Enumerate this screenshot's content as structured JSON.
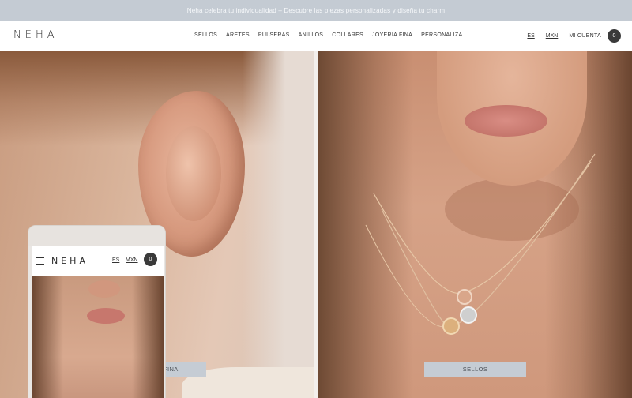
{
  "announcement": {
    "text": "Neha celebra tu individualidad – Descubre las piezas personalizadas y diseña tu charm"
  },
  "header": {
    "logo": "NEHA",
    "nav": [
      "SELLOS",
      "ARETES",
      "PULSERAS",
      "ANILLOS",
      "COLLARES",
      "JOYERIA FINA",
      "PERSONALIZA"
    ],
    "lang": "ES",
    "currency": "MXN",
    "account": "MI CUENTA",
    "cart_count": "0"
  },
  "panels": {
    "left_cta": "FINA",
    "right_cta": "SELLOS"
  },
  "phone": {
    "logo": "NEHA",
    "lang": "ES",
    "currency": "MXN",
    "cart_count": "0"
  },
  "colors": {
    "announcement_bg": "#c4cbd3",
    "cta_bg": "#c5ccd4",
    "cart_circle": "#3a3a3a"
  }
}
